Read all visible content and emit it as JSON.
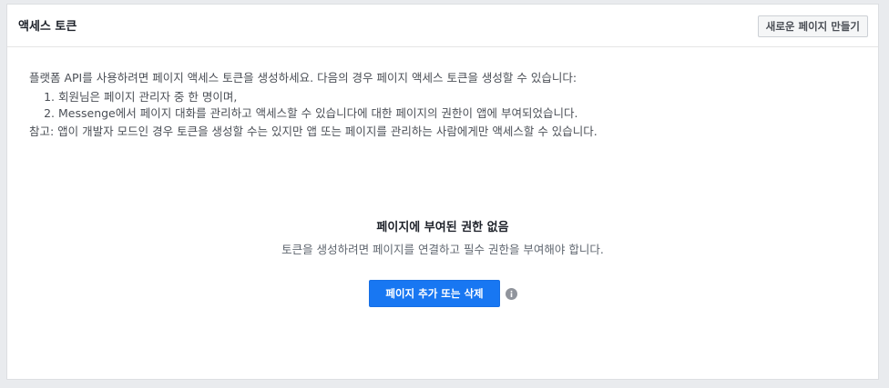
{
  "panel": {
    "title": "액세스 토큰",
    "create_button_label": "새로운 페이지 만들기"
  },
  "intro": {
    "text": "플랫폼 API를 사용하려면 페이지 액세스 토큰을 생성하세요. 다음의 경우 페이지 액세스 토큰을 생성할 수 있습니다:",
    "conditions": [
      "회원님은 페이지 관리자 중 한 명이며,",
      "Messenge에서 페이지 대화를 관리하고 액세스할 수 있습니다에 대한 페이지의 권한이 앱에 부여되었습니다."
    ],
    "note": "참고: 앱이 개발자 모드인 경우 토큰을 생성할 수는 있지만 앱 또는 페이지를 관리하는 사람에게만 액세스할 수 있습니다."
  },
  "empty_state": {
    "title": "페이지에 부여된 권한 없음",
    "description": "토큰을 생성하려면 페이지를 연결하고 필수 권한을 부여해야 합니다.",
    "button_label": "페이지 추가 또는 삭제",
    "info_icon": "info-icon"
  },
  "colors": {
    "primary_button": "#1877f2",
    "page_background": "#e9ebee",
    "panel_border": "#dddfe2"
  }
}
